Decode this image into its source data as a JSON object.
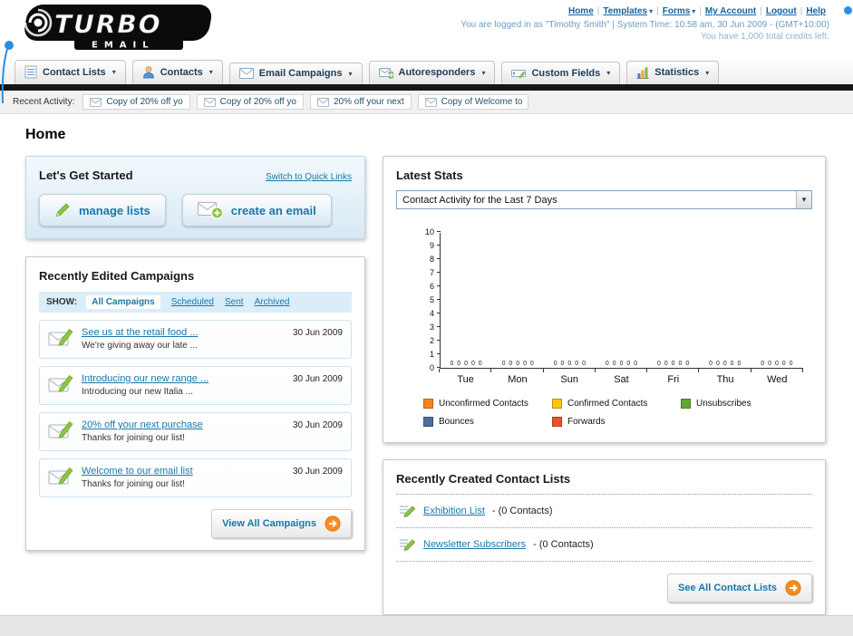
{
  "header": {
    "logo": {
      "title": "TURBO",
      "subtitle": "EMAIL"
    },
    "nav_links": [
      {
        "label": "Home"
      },
      {
        "label": "Templates",
        "caret": true
      },
      {
        "label": "Forms",
        "caret": true
      },
      {
        "label": "My Account"
      },
      {
        "label": "Logout"
      },
      {
        "label": "Help"
      }
    ],
    "session_line": "You are logged in as \"Timothy Smith\" | System Time: 10:58 am, 30 Jun 2009 - (GMT+10:00)",
    "credits_line": "You have 1,000 total credits left."
  },
  "nav_tabs": [
    {
      "label": "Contact Lists",
      "icon": "contact-lists-icon"
    },
    {
      "label": "Contacts",
      "icon": "contacts-icon"
    },
    {
      "label": "Email Campaigns",
      "icon": "email-campaigns-icon"
    },
    {
      "label": "Autoresponders",
      "icon": "autoresponders-icon"
    },
    {
      "label": "Custom Fields",
      "icon": "custom-fields-icon"
    },
    {
      "label": "Statistics",
      "icon": "statistics-icon"
    }
  ],
  "recent_activity": {
    "label": "Recent Activity:",
    "items": [
      "Copy of 20% off yo",
      "Copy of 20% off yo",
      "20% off your next",
      "Copy of Welcome to"
    ]
  },
  "page": {
    "title": "Home"
  },
  "get_started": {
    "title": "Let's Get Started",
    "switch_link": "Switch to Quick Links",
    "manage_lists": "manage lists",
    "create_email": "create an email"
  },
  "campaigns": {
    "title": "Recently Edited Campaigns",
    "show_label": "SHOW:",
    "filters": [
      {
        "label": "All Campaigns",
        "active": true
      },
      {
        "label": "Scheduled"
      },
      {
        "label": "Sent"
      },
      {
        "label": "Archived"
      }
    ],
    "items": [
      {
        "title": "See us at the retail food ...",
        "subtitle": "We're giving away our late ...",
        "date": "30 Jun 2009"
      },
      {
        "title": "Introducing our new range ...",
        "subtitle": "Introducing our new Italia ...",
        "date": "30 Jun 2009"
      },
      {
        "title": "20% off your next purchase",
        "subtitle": "Thanks for joining our list!",
        "date": "30 Jun 2009"
      },
      {
        "title": "Welcome to our email list",
        "subtitle": "Thanks for joining our list!",
        "date": "30 Jun 2009"
      }
    ],
    "view_all_label": "View All Campaigns"
  },
  "stats": {
    "title": "Latest Stats",
    "selected_option": "Contact Activity for the Last 7 Days"
  },
  "chart_data": {
    "type": "bar",
    "title": "Contact Activity for the Last 7 Days",
    "categories": [
      "Tue",
      "Mon",
      "Sun",
      "Sat",
      "Fri",
      "Thu",
      "Wed"
    ],
    "series": [
      {
        "name": "Unconfirmed Contacts",
        "color": "#f5831f",
        "values": [
          0,
          0,
          0,
          0,
          0,
          0,
          0
        ]
      },
      {
        "name": "Confirmed Contacts",
        "color": "#fdc40d",
        "values": [
          0,
          0,
          0,
          0,
          0,
          0,
          0
        ]
      },
      {
        "name": "Unsubscribes",
        "color": "#62a730",
        "values": [
          0,
          0,
          0,
          0,
          0,
          0,
          0
        ]
      },
      {
        "name": "Bounces",
        "color": "#4e6d9e",
        "values": [
          0,
          0,
          0,
          0,
          0,
          0,
          0
        ]
      },
      {
        "name": "Forwards",
        "color": "#e8532a",
        "values": [
          0,
          0,
          0,
          0,
          0,
          0,
          0
        ]
      }
    ],
    "ylim": [
      0,
      10
    ],
    "yticks": [
      0,
      1,
      2,
      3,
      4,
      5,
      6,
      7,
      8,
      9,
      10
    ],
    "grid": false,
    "legend_position": "bottom"
  },
  "contact_lists": {
    "title": "Recently Created Contact Lists",
    "items": [
      {
        "name": "Exhibition List",
        "suffix": " - (0 Contacts)"
      },
      {
        "name": "Newsletter Subscribers",
        "suffix": " - (0 Contacts)"
      }
    ],
    "see_all_label": "See All Contact Lists"
  },
  "colors": {
    "link_blue": "#1878a9",
    "nav_text": "#1d3c57",
    "accent_orange": "#f68b1f",
    "accent_green": "#8dc63f",
    "bar_black": "#161616"
  }
}
